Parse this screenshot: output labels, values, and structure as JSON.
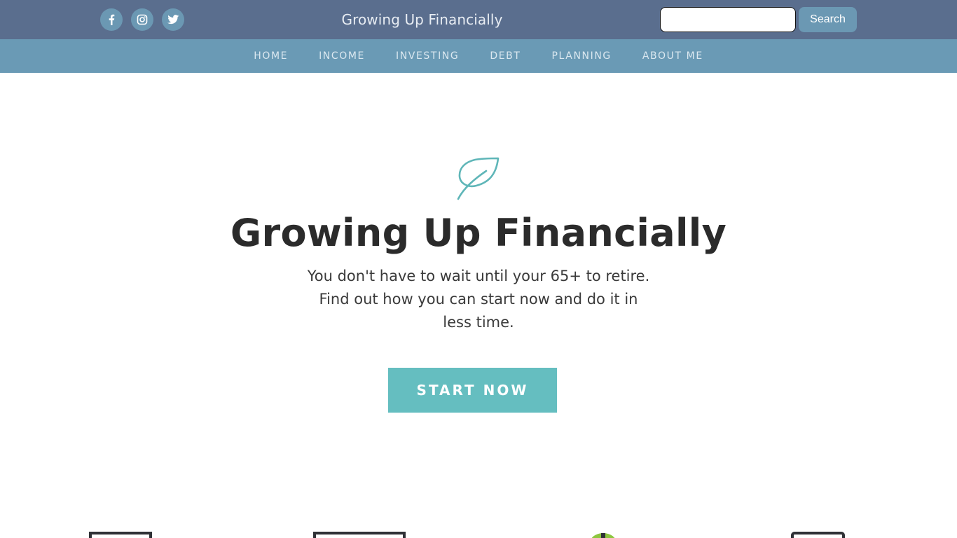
{
  "header": {
    "social": [
      {
        "icon": "facebook-icon"
      },
      {
        "icon": "instagram-icon"
      },
      {
        "icon": "twitter-icon"
      }
    ],
    "site_title": "Growing Up Financially",
    "search": {
      "placeholder": "",
      "button_label": "Search"
    }
  },
  "nav": {
    "items": [
      {
        "label": "HOME"
      },
      {
        "label": "INCOME"
      },
      {
        "label": "INVESTING"
      },
      {
        "label": "DEBT"
      },
      {
        "label": "PLANNING"
      },
      {
        "label": "ABOUT ME"
      }
    ]
  },
  "hero": {
    "icon": "leaf-icon",
    "title": "Growing Up Financially",
    "subtitle": "You don't have to wait until your 65+ to retire. Find out how you can start now and do it in less time.",
    "cta_label": "START NOW"
  },
  "features": {
    "icons": [
      "monitor-icon",
      "laptop-icon",
      "money-bag-icon",
      "tablet-icon"
    ]
  },
  "colors": {
    "topbar": "#5a6e8e",
    "navbar": "#6a9ab5",
    "accent": "#65bec0",
    "social_circle": "#6b98b3"
  }
}
